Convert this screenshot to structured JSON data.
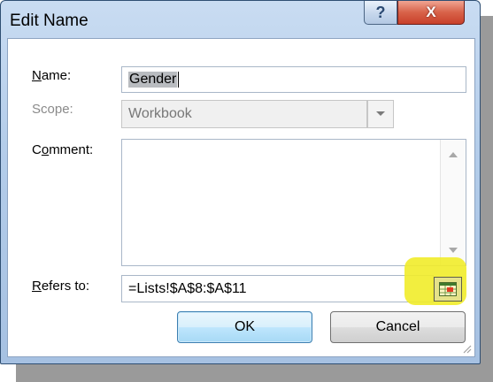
{
  "window": {
    "title": "Edit Name",
    "help_glyph": "?",
    "close_glyph": "X"
  },
  "form": {
    "name_label_key": "N",
    "name_label_rest": "ame:",
    "name_value": "Gender",
    "scope_label": "Scope:",
    "scope_value": "Workbook",
    "comment_label_pre": "C",
    "comment_label_key": "o",
    "comment_label_rest": "mment:",
    "comment_value": "",
    "refers_label_key": "R",
    "refers_label_rest": "efers to:",
    "refers_value": "=Lists!$A$8:$A$11"
  },
  "buttons": {
    "ok_label": "OK",
    "cancel_label": "Cancel"
  },
  "colors": {
    "highlight": "#f1ec2a",
    "close_button": "#d86249"
  },
  "icons": {
    "help": "help-icon",
    "close": "close-icon",
    "dropdown": "chevron-down-icon",
    "collapse_dialog": "collapse-dialog-icon"
  }
}
